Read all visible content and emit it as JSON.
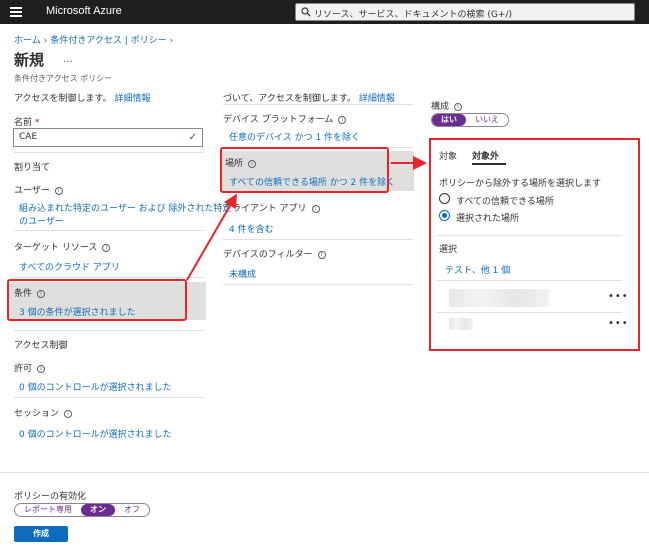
{
  "topbar": {
    "brand": "Microsoft Azure",
    "search_placeholder": "リソース、サービス、ドキュメントの検索 (G+/)"
  },
  "breadcrumb": [
    "ホーム",
    "条件付きアクセス | ポリシー"
  ],
  "page": {
    "title": "新規",
    "more": "...",
    "subtitle": "条件付きアクセス ポリシー"
  },
  "left": {
    "intro": "アクセスを制御します。",
    "intro_link": "詳細情報",
    "name_label": "名前",
    "required_mark": "*",
    "name_value": "CAE",
    "assignments_heading": "割り当て",
    "users_label": "ユーザー",
    "users_value_line1": "組み込まれた特定のユーザー および 除外された特定",
    "users_value_line2": "のユーザー",
    "target_label": "ターゲット リソース",
    "target_value": "すべてのクラウド アプリ",
    "conditions_label": "条件",
    "conditions_value": "3 個の条件が選択されました",
    "access_control_heading": "アクセス制御",
    "grant_label": "許可",
    "grant_value": "0 個のコントロールが選択されました",
    "session_label": "セッション",
    "session_value": "0 個のコントロールが選択されました"
  },
  "middle": {
    "intro": "づいて、アクセスを制御します。",
    "intro_link": "詳細情報",
    "device_platform_label": "デバイス プラットフォーム",
    "device_platform_value": "任意のデバイス かつ 1 件を除く",
    "locations_label": "場所",
    "locations_value": "すべての信頼できる場所 かつ 2 件を除く",
    "client_apps_label": "クライアント アプリ",
    "client_apps_value": "4 件を含む",
    "device_filter_label": "デバイスのフィルター",
    "device_filter_value": "未構成"
  },
  "config": {
    "label": "構成",
    "yes": "はい",
    "no": "いいえ"
  },
  "panel": {
    "tab_include": "対象",
    "tab_exclude": "対象外",
    "prompt": "ポリシーから除外する場所を選択します",
    "option_all_trusted": "すべての信頼できる場所",
    "option_selected": "選択された場所",
    "select_label": "選択",
    "select_value": "テスト、他 1 個",
    "more": "•••"
  },
  "footer": {
    "enable_label": "ポリシーの有効化",
    "report_only": "レポート専用",
    "on": "オン",
    "off": "オフ",
    "create": "作成"
  },
  "colors": {
    "accent": "#0f6cbd",
    "toggle_on": "#6b2c91",
    "annotation_red": "#e8252a",
    "topbar": "#1f1f1f"
  }
}
